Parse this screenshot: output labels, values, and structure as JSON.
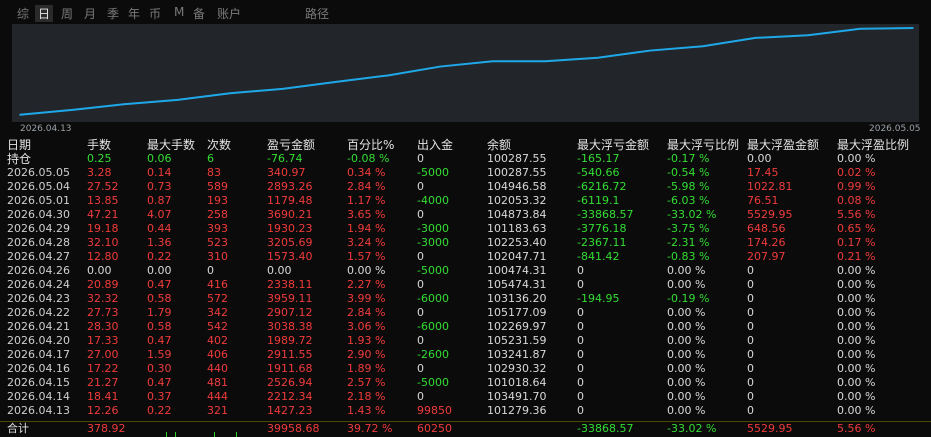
{
  "tabs": [
    {
      "label": "综",
      "active": false
    },
    {
      "label": "日",
      "active": true
    },
    {
      "label": "周",
      "active": false
    },
    {
      "label": "月",
      "active": false
    },
    {
      "label": "季",
      "active": false
    },
    {
      "label": "年",
      "active": false
    },
    {
      "label": "币",
      "active": false
    },
    {
      "label": "M",
      "active": false
    },
    {
      "label": "备",
      "active": false
    },
    {
      "label": "账户",
      "active": false
    },
    {
      "label": "路径",
      "active": false
    }
  ],
  "chart": {
    "start_date": "2026.04.13",
    "end_date": "2026.05.05",
    "line_color": "#1fa8e8",
    "background": "#22262b"
  },
  "chart_data": {
    "type": "line",
    "x": [
      "2026.04.13",
      "2026.04.14",
      "2026.04.15",
      "2026.04.16",
      "2026.04.17",
      "2026.04.20",
      "2026.04.21",
      "2026.04.22",
      "2026.04.23",
      "2026.04.24",
      "2026.04.26",
      "2026.04.27",
      "2026.04.28",
      "2026.04.29",
      "2026.04.30",
      "2026.05.01",
      "2026.05.04",
      "2026.05.05"
    ],
    "y": [
      1427.23,
      3639.57,
      6166.51,
      8078.2,
      10989.75,
      12979.47,
      16017.85,
      18924.97,
      22884.08,
      25222.19,
      25222.19,
      26795.59,
      30001.28,
      31931.51,
      35622.72,
      36802.2,
      39695.46,
      40036.43
    ]
  },
  "colors": {
    "profit": "#f03b3b",
    "loss": "#33dd33",
    "neutral": "#d8d8d8"
  },
  "table": {
    "headers": [
      "日期",
      "手数",
      "最大手数",
      "次数",
      "盈亏金额",
      "百分比%",
      "出入金",
      "余额",
      "最大浮亏金额",
      "最大浮亏比例",
      "最大浮盈金额",
      "最大浮盈比例"
    ],
    "hold": {
      "label": "持仓",
      "cells": [
        {
          "v": "0.25",
          "c": "green"
        },
        {
          "v": "0.06",
          "c": "green"
        },
        {
          "v": "6",
          "c": "green"
        },
        {
          "v": "-76.74",
          "c": "green"
        },
        {
          "v": "-0.08 %",
          "c": "green"
        },
        {
          "v": "0",
          "c": "white"
        },
        {
          "v": "100287.55",
          "c": "white"
        },
        {
          "v": "-165.17",
          "c": "green"
        },
        {
          "v": "-0.17 %",
          "c": "green"
        },
        {
          "v": "0.00",
          "c": "white"
        },
        {
          "v": "0.00 %",
          "c": "white"
        }
      ]
    },
    "rows": [
      {
        "date": "2026.05.05",
        "cells": [
          {
            "v": "3.28",
            "c": "red"
          },
          {
            "v": "0.14",
            "c": "red"
          },
          {
            "v": "83",
            "c": "red"
          },
          {
            "v": "340.97",
            "c": "red"
          },
          {
            "v": "0.34 %",
            "c": "red"
          },
          {
            "v": "-5000",
            "c": "green"
          },
          {
            "v": "100287.55",
            "c": "white"
          },
          {
            "v": "-540.66",
            "c": "green"
          },
          {
            "v": "-0.54 %",
            "c": "green"
          },
          {
            "v": "17.45",
            "c": "red"
          },
          {
            "v": "0.02 %",
            "c": "red"
          }
        ]
      },
      {
        "date": "2026.05.04",
        "cells": [
          {
            "v": "27.52",
            "c": "red"
          },
          {
            "v": "0.73",
            "c": "red"
          },
          {
            "v": "589",
            "c": "red"
          },
          {
            "v": "2893.26",
            "c": "red"
          },
          {
            "v": "2.84 %",
            "c": "red"
          },
          {
            "v": "0",
            "c": "white"
          },
          {
            "v": "104946.58",
            "c": "white"
          },
          {
            "v": "-6216.72",
            "c": "green"
          },
          {
            "v": "-5.98 %",
            "c": "green"
          },
          {
            "v": "1022.81",
            "c": "red"
          },
          {
            "v": "0.99 %",
            "c": "red"
          }
        ]
      },
      {
        "date": "2026.05.01",
        "cells": [
          {
            "v": "13.85",
            "c": "red"
          },
          {
            "v": "0.87",
            "c": "red"
          },
          {
            "v": "193",
            "c": "red"
          },
          {
            "v": "1179.48",
            "c": "red"
          },
          {
            "v": "1.17 %",
            "c": "red"
          },
          {
            "v": "-4000",
            "c": "green"
          },
          {
            "v": "102053.32",
            "c": "white"
          },
          {
            "v": "-6119.1",
            "c": "green"
          },
          {
            "v": "-6.03 %",
            "c": "green"
          },
          {
            "v": "76.51",
            "c": "red"
          },
          {
            "v": "0.08 %",
            "c": "red"
          }
        ]
      },
      {
        "date": "2026.04.30",
        "cells": [
          {
            "v": "47.21",
            "c": "red"
          },
          {
            "v": "4.07",
            "c": "red"
          },
          {
            "v": "258",
            "c": "red"
          },
          {
            "v": "3690.21",
            "c": "red"
          },
          {
            "v": "3.65 %",
            "c": "red"
          },
          {
            "v": "0",
            "c": "white"
          },
          {
            "v": "104873.84",
            "c": "white"
          },
          {
            "v": "-33868.57",
            "c": "green"
          },
          {
            "v": "-33.02 %",
            "c": "green"
          },
          {
            "v": "5529.95",
            "c": "red"
          },
          {
            "v": "5.56 %",
            "c": "red"
          }
        ]
      },
      {
        "date": "2026.04.29",
        "cells": [
          {
            "v": "19.18",
            "c": "red"
          },
          {
            "v": "0.44",
            "c": "red"
          },
          {
            "v": "393",
            "c": "red"
          },
          {
            "v": "1930.23",
            "c": "red"
          },
          {
            "v": "1.94 %",
            "c": "red"
          },
          {
            "v": "-3000",
            "c": "green"
          },
          {
            "v": "101183.63",
            "c": "white"
          },
          {
            "v": "-3776.18",
            "c": "green"
          },
          {
            "v": "-3.75 %",
            "c": "green"
          },
          {
            "v": "648.56",
            "c": "red"
          },
          {
            "v": "0.65 %",
            "c": "red"
          }
        ]
      },
      {
        "date": "2026.04.28",
        "cells": [
          {
            "v": "32.10",
            "c": "red"
          },
          {
            "v": "1.36",
            "c": "red"
          },
          {
            "v": "523",
            "c": "red"
          },
          {
            "v": "3205.69",
            "c": "red"
          },
          {
            "v": "3.24 %",
            "c": "red"
          },
          {
            "v": "-3000",
            "c": "green"
          },
          {
            "v": "102253.40",
            "c": "white"
          },
          {
            "v": "-2367.11",
            "c": "green"
          },
          {
            "v": "-2.31 %",
            "c": "green"
          },
          {
            "v": "174.26",
            "c": "red"
          },
          {
            "v": "0.17 %",
            "c": "red"
          }
        ]
      },
      {
        "date": "2026.04.27",
        "cells": [
          {
            "v": "12.80",
            "c": "red"
          },
          {
            "v": "0.22",
            "c": "red"
          },
          {
            "v": "310",
            "c": "red"
          },
          {
            "v": "1573.40",
            "c": "red"
          },
          {
            "v": "1.57 %",
            "c": "red"
          },
          {
            "v": "0",
            "c": "white"
          },
          {
            "v": "102047.71",
            "c": "white"
          },
          {
            "v": "-841.42",
            "c": "green"
          },
          {
            "v": "-0.83 %",
            "c": "green"
          },
          {
            "v": "207.97",
            "c": "red"
          },
          {
            "v": "0.21 %",
            "c": "red"
          }
        ]
      },
      {
        "date": "2026.04.26",
        "cells": [
          {
            "v": "0.00",
            "c": "white"
          },
          {
            "v": "0.00",
            "c": "white"
          },
          {
            "v": "0",
            "c": "white"
          },
          {
            "v": "0.00",
            "c": "white"
          },
          {
            "v": "0.00 %",
            "c": "white"
          },
          {
            "v": "-5000",
            "c": "green"
          },
          {
            "v": "100474.31",
            "c": "white"
          },
          {
            "v": "0",
            "c": "white"
          },
          {
            "v": "0.00 %",
            "c": "white"
          },
          {
            "v": "0",
            "c": "white"
          },
          {
            "v": "0.00 %",
            "c": "white"
          }
        ]
      },
      {
        "date": "2026.04.24",
        "cells": [
          {
            "v": "20.89",
            "c": "red"
          },
          {
            "v": "0.47",
            "c": "red"
          },
          {
            "v": "416",
            "c": "red"
          },
          {
            "v": "2338.11",
            "c": "red"
          },
          {
            "v": "2.27 %",
            "c": "red"
          },
          {
            "v": "0",
            "c": "white"
          },
          {
            "v": "105474.31",
            "c": "white"
          },
          {
            "v": "0",
            "c": "white"
          },
          {
            "v": "0.00 %",
            "c": "white"
          },
          {
            "v": "0",
            "c": "white"
          },
          {
            "v": "0.00 %",
            "c": "white"
          }
        ]
      },
      {
        "date": "2026.04.23",
        "cells": [
          {
            "v": "32.32",
            "c": "red"
          },
          {
            "v": "0.58",
            "c": "red"
          },
          {
            "v": "572",
            "c": "red"
          },
          {
            "v": "3959.11",
            "c": "red"
          },
          {
            "v": "3.99 %",
            "c": "red"
          },
          {
            "v": "-6000",
            "c": "green"
          },
          {
            "v": "103136.20",
            "c": "white"
          },
          {
            "v": "-194.95",
            "c": "green"
          },
          {
            "v": "-0.19 %",
            "c": "green"
          },
          {
            "v": "0",
            "c": "white"
          },
          {
            "v": "0.00 %",
            "c": "white"
          }
        ]
      },
      {
        "date": "2026.04.22",
        "cells": [
          {
            "v": "27.73",
            "c": "red"
          },
          {
            "v": "1.79",
            "c": "red"
          },
          {
            "v": "342",
            "c": "red"
          },
          {
            "v": "2907.12",
            "c": "red"
          },
          {
            "v": "2.84 %",
            "c": "red"
          },
          {
            "v": "0",
            "c": "white"
          },
          {
            "v": "105177.09",
            "c": "white"
          },
          {
            "v": "0",
            "c": "white"
          },
          {
            "v": "0.00 %",
            "c": "white"
          },
          {
            "v": "0",
            "c": "white"
          },
          {
            "v": "0.00 %",
            "c": "white"
          }
        ]
      },
      {
        "date": "2026.04.21",
        "cells": [
          {
            "v": "28.30",
            "c": "red"
          },
          {
            "v": "0.58",
            "c": "red"
          },
          {
            "v": "542",
            "c": "red"
          },
          {
            "v": "3038.38",
            "c": "red"
          },
          {
            "v": "3.06 %",
            "c": "red"
          },
          {
            "v": "-6000",
            "c": "green"
          },
          {
            "v": "102269.97",
            "c": "white"
          },
          {
            "v": "0",
            "c": "white"
          },
          {
            "v": "0.00 %",
            "c": "white"
          },
          {
            "v": "0",
            "c": "white"
          },
          {
            "v": "0.00 %",
            "c": "white"
          }
        ]
      },
      {
        "date": "2026.04.20",
        "cells": [
          {
            "v": "17.33",
            "c": "red"
          },
          {
            "v": "0.47",
            "c": "red"
          },
          {
            "v": "402",
            "c": "red"
          },
          {
            "v": "1989.72",
            "c": "red"
          },
          {
            "v": "1.93 %",
            "c": "red"
          },
          {
            "v": "0",
            "c": "white"
          },
          {
            "v": "105231.59",
            "c": "white"
          },
          {
            "v": "0",
            "c": "white"
          },
          {
            "v": "0.00 %",
            "c": "white"
          },
          {
            "v": "0",
            "c": "white"
          },
          {
            "v": "0.00 %",
            "c": "white"
          }
        ]
      },
      {
        "date": "2026.04.17",
        "cells": [
          {
            "v": "27.00",
            "c": "red"
          },
          {
            "v": "1.59",
            "c": "red"
          },
          {
            "v": "406",
            "c": "red"
          },
          {
            "v": "2911.55",
            "c": "red"
          },
          {
            "v": "2.90 %",
            "c": "red"
          },
          {
            "v": "-2600",
            "c": "green"
          },
          {
            "v": "103241.87",
            "c": "white"
          },
          {
            "v": "0",
            "c": "white"
          },
          {
            "v": "0.00 %",
            "c": "white"
          },
          {
            "v": "0",
            "c": "white"
          },
          {
            "v": "0.00 %",
            "c": "white"
          }
        ]
      },
      {
        "date": "2026.04.16",
        "cells": [
          {
            "v": "17.22",
            "c": "red"
          },
          {
            "v": "0.30",
            "c": "red"
          },
          {
            "v": "440",
            "c": "red"
          },
          {
            "v": "1911.68",
            "c": "red"
          },
          {
            "v": "1.89 %",
            "c": "red"
          },
          {
            "v": "0",
            "c": "white"
          },
          {
            "v": "102930.32",
            "c": "white"
          },
          {
            "v": "0",
            "c": "white"
          },
          {
            "v": "0.00 %",
            "c": "white"
          },
          {
            "v": "0",
            "c": "white"
          },
          {
            "v": "0.00 %",
            "c": "white"
          }
        ]
      },
      {
        "date": "2026.04.15",
        "cells": [
          {
            "v": "21.27",
            "c": "red"
          },
          {
            "v": "0.47",
            "c": "red"
          },
          {
            "v": "481",
            "c": "red"
          },
          {
            "v": "2526.94",
            "c": "red"
          },
          {
            "v": "2.57 %",
            "c": "red"
          },
          {
            "v": "-5000",
            "c": "green"
          },
          {
            "v": "101018.64",
            "c": "white"
          },
          {
            "v": "0",
            "c": "white"
          },
          {
            "v": "0.00 %",
            "c": "white"
          },
          {
            "v": "0",
            "c": "white"
          },
          {
            "v": "0.00 %",
            "c": "white"
          }
        ]
      },
      {
        "date": "2026.04.14",
        "cells": [
          {
            "v": "18.41",
            "c": "red"
          },
          {
            "v": "0.37",
            "c": "red"
          },
          {
            "v": "444",
            "c": "red"
          },
          {
            "v": "2212.34",
            "c": "red"
          },
          {
            "v": "2.18 %",
            "c": "red"
          },
          {
            "v": "0",
            "c": "white"
          },
          {
            "v": "103491.70",
            "c": "white"
          },
          {
            "v": "0",
            "c": "white"
          },
          {
            "v": "0.00 %",
            "c": "white"
          },
          {
            "v": "0",
            "c": "white"
          },
          {
            "v": "0.00 %",
            "c": "white"
          }
        ]
      },
      {
        "date": "2026.04.13",
        "cells": [
          {
            "v": "12.26",
            "c": "red"
          },
          {
            "v": "0.22",
            "c": "red"
          },
          {
            "v": "321",
            "c": "red"
          },
          {
            "v": "1427.23",
            "c": "red"
          },
          {
            "v": "1.43 %",
            "c": "red"
          },
          {
            "v": "99850",
            "c": "red"
          },
          {
            "v": "101279.36",
            "c": "white"
          },
          {
            "v": "0",
            "c": "white"
          },
          {
            "v": "0.00 %",
            "c": "white"
          },
          {
            "v": "0",
            "c": "white"
          },
          {
            "v": "0.00 %",
            "c": "white"
          }
        ]
      }
    ],
    "total": {
      "label": "合计",
      "cells": [
        {
          "v": "378.92",
          "c": "red"
        },
        {
          "v": "",
          "c": "white"
        },
        {
          "v": "",
          "c": "white"
        },
        {
          "v": "39958.68",
          "c": "red"
        },
        {
          "v": "39.72 %",
          "c": "red"
        },
        {
          "v": "60250",
          "c": "red"
        },
        {
          "v": "",
          "c": "white"
        },
        {
          "v": "-33868.57",
          "c": "green"
        },
        {
          "v": "-33.02 %",
          "c": "green"
        },
        {
          "v": "5529.95",
          "c": "red"
        },
        {
          "v": "5.56 %",
          "c": "red"
        }
      ]
    }
  }
}
